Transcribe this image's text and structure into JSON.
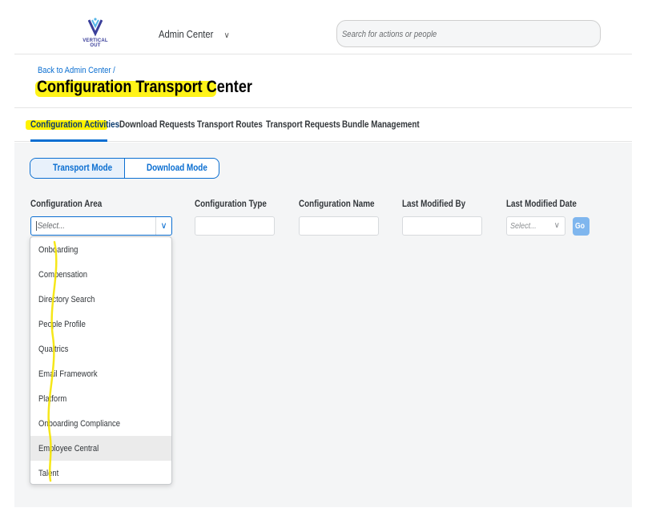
{
  "shell": {
    "logo_text_line1": "VERTICAL",
    "logo_text_line2": "OUT",
    "product_menu": "Admin Center",
    "search_placeholder": "Search for actions or people"
  },
  "page": {
    "back_link": "Back to Admin Center /",
    "title": "Configuration Transport Center"
  },
  "tabs": [
    {
      "label": "Configuration Activities",
      "active": true
    },
    {
      "label": "Download Requests"
    },
    {
      "label": "Transport Routes"
    },
    {
      "label": "Transport Requests"
    },
    {
      "label": "Bundle Management"
    }
  ],
  "mode": {
    "transport": "Transport Mode",
    "download": "Download Mode"
  },
  "filters": {
    "area_label": "Configuration Area",
    "area_placeholder": "Select...",
    "type_label": "Configuration Type",
    "name_label": "Configuration Name",
    "modified_by_label": "Last Modified By",
    "modified_date_label": "Last Modified Date",
    "date_placeholder": "Select...",
    "go_label": "Go"
  },
  "dropdown_options": [
    "Onboarding",
    "Compensation",
    "Directory Search",
    "People Profile",
    "Qualtrics",
    "Email Framework",
    "Platform",
    "Onboarding Compliance",
    "Employee Central",
    "Talent"
  ],
  "colors": {
    "accent": "#0a6ed1",
    "highlighter": "#fff200",
    "hover_row": "#ebebeb"
  }
}
